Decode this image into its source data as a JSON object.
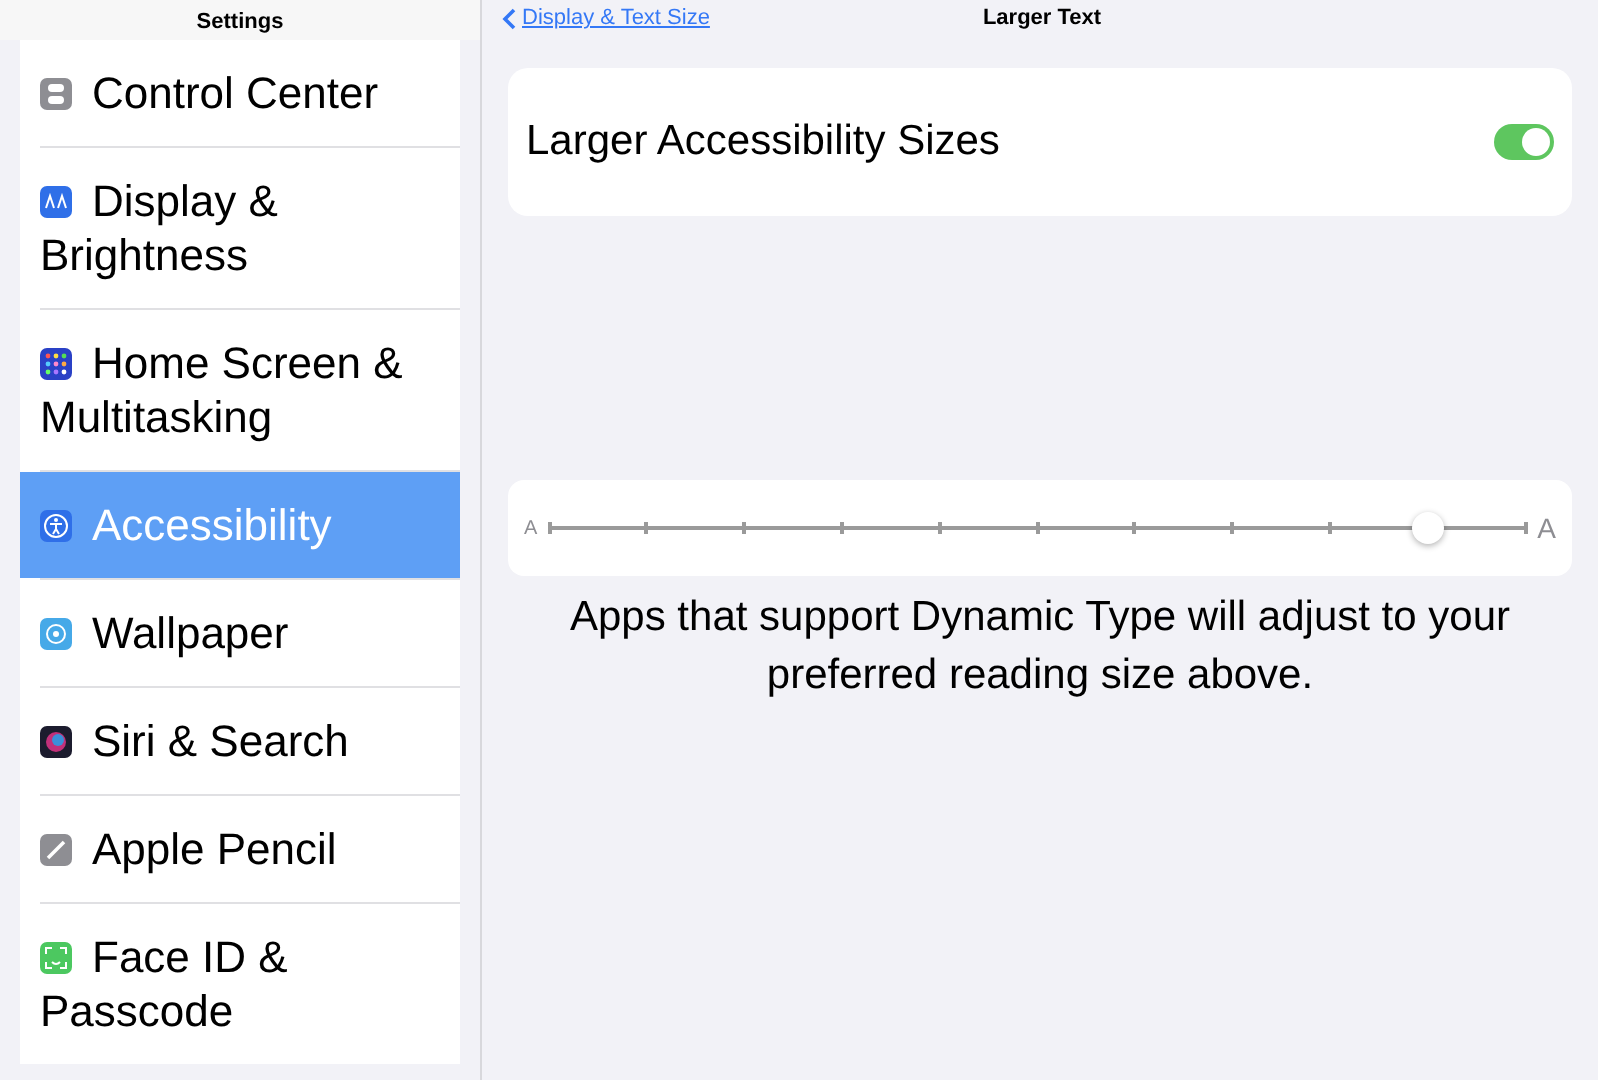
{
  "sidebar": {
    "title": "Settings",
    "items": [
      {
        "label": "Control Center",
        "selected": false
      },
      {
        "label": "Display & Brightness",
        "selected": false
      },
      {
        "label": "Home Screen & Multitasking",
        "selected": false
      },
      {
        "label": "Accessibility",
        "selected": true
      },
      {
        "label": "Wallpaper",
        "selected": false
      },
      {
        "label": "Siri & Search",
        "selected": false
      },
      {
        "label": "Apple Pencil",
        "selected": false
      },
      {
        "label": "Face ID & Passcode",
        "selected": false
      }
    ]
  },
  "nav": {
    "back": "Display & Text Size",
    "title": "Larger Text"
  },
  "toggle_row": {
    "label": "Larger Accessibility Sizes",
    "on": true
  },
  "slider": {
    "small_label": "A",
    "large_label": "A",
    "level": 0.9
  },
  "footer": "Apps that support Dynamic Type will adjust to your preferred reading size above."
}
